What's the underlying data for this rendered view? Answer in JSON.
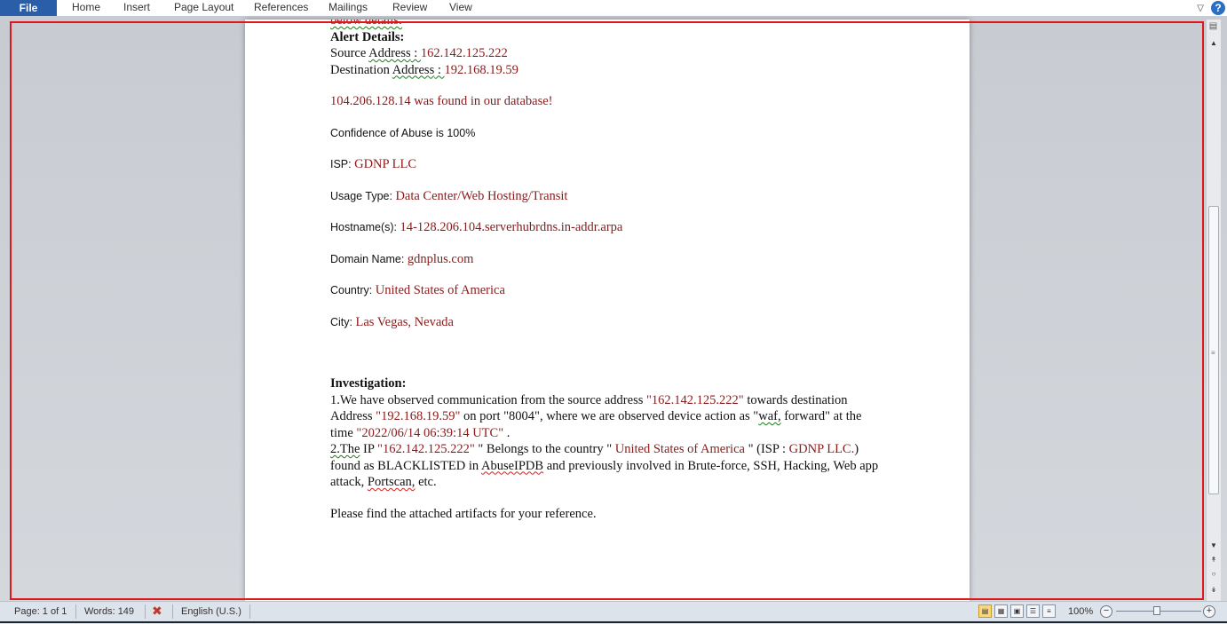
{
  "ribbon": {
    "file_label": "File",
    "tabs": [
      "Home",
      "Insert",
      "Page Layout",
      "References",
      "Mailings",
      "Review",
      "View"
    ],
    "help_icon": "help-icon",
    "minimize_icon": "chevron-down-icon"
  },
  "document": {
    "partial_top_line": "below details:",
    "alert_heading": "Alert Details:",
    "source_label": "Source ",
    "source_word": "Address",
    "source_colon": " : ",
    "source_value": "162.142.125.222",
    "dest_label": "Destination ",
    "dest_word": "Address",
    "dest_colon": " : ",
    "dest_value": "192.168.19.59",
    "found_line": " 104.206.128.14 was found in our database!",
    "confidence_label": "Confidence of Abuse is ",
    "confidence_value": "100%",
    "isp_label": "ISP: ",
    "isp_value": "GDNP LLC",
    "usage_label": "Usage Type: ",
    "usage_value": "Data Center/Web Hosting/Transit",
    "hostname_label": "Hostname(s): ",
    "hostname_value": "14-128.206.104.serverhubrdns.in-addr.arpa",
    "domain_label": "Domain Name:  ",
    "domain_value": "gdnplus.com",
    "country_label": "Country:  ",
    "country_value": "United States of America",
    "city_label": "City: ",
    "city_value": "Las Vegas, Nevada",
    "investigation_heading": "Investigation:",
    "inv1_a": "1.We have observed communication  from the source address ",
    "inv1_src": "\"162.142.125.222\"",
    "inv1_b": " towards destination Address ",
    "inv1_dst": "\"192.168.19.59\"",
    "inv1_c": " on port \"8004\", where we are observed device action as \"",
    "inv1_waf": "waf,",
    "inv1_d": " forward\" at the time ",
    "inv1_time": "\"2022/06/14  06:39:14  UTC\"",
    "inv1_e": " .",
    "inv2_num": "2.The",
    "inv2_a": " IP ",
    "inv2_ip": "\"162.142.125.222\"",
    "inv2_b": " \" Belongs to the country \" ",
    "inv2_country": "United States of America",
    "inv2_c": "  \" (ISP : ",
    "inv2_isp": "GDNP LLC.",
    "inv2_d": ") found as BLACKLISTED in ",
    "inv2_abuse": "AbuseIPDB",
    "inv2_e": " and previously involved in Brute-force, SSH, Hacking, Web app attack, ",
    "inv2_portscan": "Portscan,",
    "inv2_f": " etc.",
    "closing": "Please  find the attached artifacts for your reference."
  },
  "status_bar": {
    "page": "Page: 1 of 1",
    "words": "Words: 149",
    "language": "English (U.S.)",
    "zoom": "100%",
    "zoom_minus": "−",
    "zoom_plus": "+"
  }
}
